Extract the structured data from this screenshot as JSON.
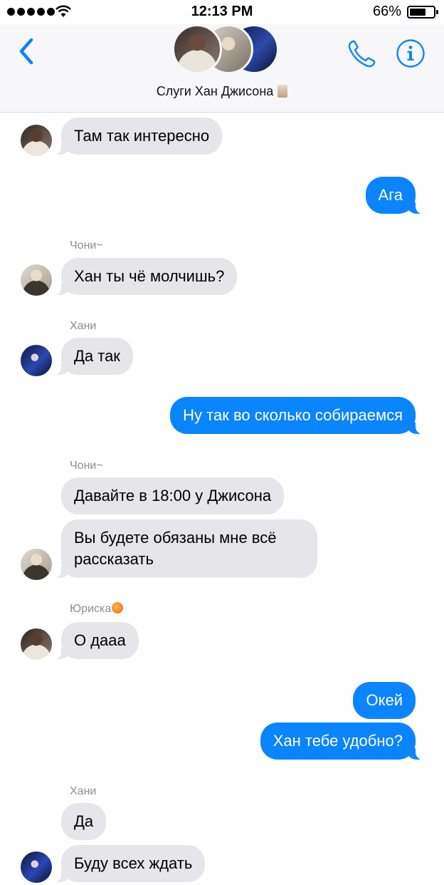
{
  "status_bar": {
    "time": "12:13 PM",
    "battery_percent": "66%",
    "battery_level": 0.66,
    "signal_icon": "signal-dots-icon",
    "wifi_icon": "wifi-icon"
  },
  "header": {
    "back_icon": "chevron-left-icon",
    "group_name": "Слуги Хан Джисона",
    "call_icon": "phone-icon",
    "info_icon": "info-icon",
    "accent_color": "#0a84ff"
  },
  "messages": [
    {
      "direction": "incoming",
      "sender": "",
      "text": "Там так интересно"
    },
    {
      "direction": "outgoing",
      "text": "Ага"
    },
    {
      "direction": "incoming",
      "sender": "Чони~",
      "text": "Хан ты чё молчишь?"
    },
    {
      "direction": "incoming",
      "sender": "Хани",
      "text": "Да так"
    },
    {
      "direction": "outgoing",
      "text": "Ну так во сколько собираемся"
    },
    {
      "direction": "incoming",
      "sender": "Чони~",
      "text": "Давайте в 18:00 у Джисона"
    },
    {
      "direction": "incoming",
      "sender": "",
      "text": "Вы будете обязаны мне всё рассказать"
    },
    {
      "direction": "incoming",
      "sender": "Юриска",
      "text": "О дааа"
    },
    {
      "direction": "outgoing",
      "text": "Окей"
    },
    {
      "direction": "outgoing",
      "text": "Хан тебе удобно?"
    },
    {
      "direction": "incoming",
      "sender": "Хани",
      "text": "Да"
    },
    {
      "direction": "incoming",
      "sender": "",
      "text": "Буду всех ждать"
    }
  ],
  "colors": {
    "incoming_bubble": "#e5e5ea",
    "outgoing_bubble": "#0a84ff",
    "sender_label": "#8e8e93"
  }
}
